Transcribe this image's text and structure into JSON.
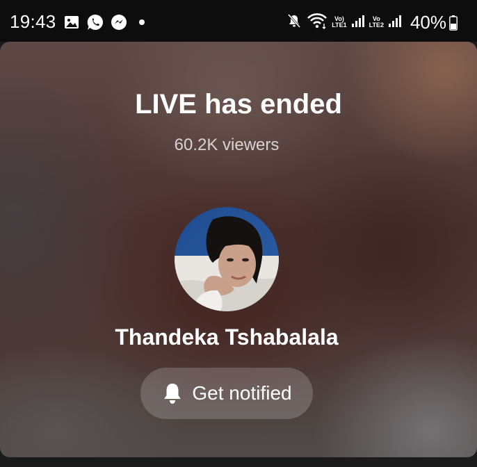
{
  "status_bar": {
    "time": "19:43",
    "left_icons": [
      "gallery-icon",
      "whatsapp-icon",
      "messenger-icon",
      "notification-dot"
    ],
    "right_icons": [
      "mute-icon",
      "wifi-icon",
      "signal-icon-1",
      "signal-icon-2",
      "battery-icon"
    ],
    "sim1_label_top": "Vo)",
    "sim1_label_bottom": "LTE1",
    "sim2_label_top": "Vo",
    "sim2_label_bottom": "LTE2",
    "battery": "40%"
  },
  "live_end": {
    "title": "LIVE has ended",
    "viewers": "60.2K viewers",
    "username": "Thandeka Tshabalala",
    "notify_button": "Get notified"
  },
  "colors": {
    "status_bar_bg": "#0d0d0d",
    "button_bg": "rgba(255,255,255,0.18)",
    "text_primary": "#ffffff",
    "text_secondary": "#d9d2d0"
  }
}
